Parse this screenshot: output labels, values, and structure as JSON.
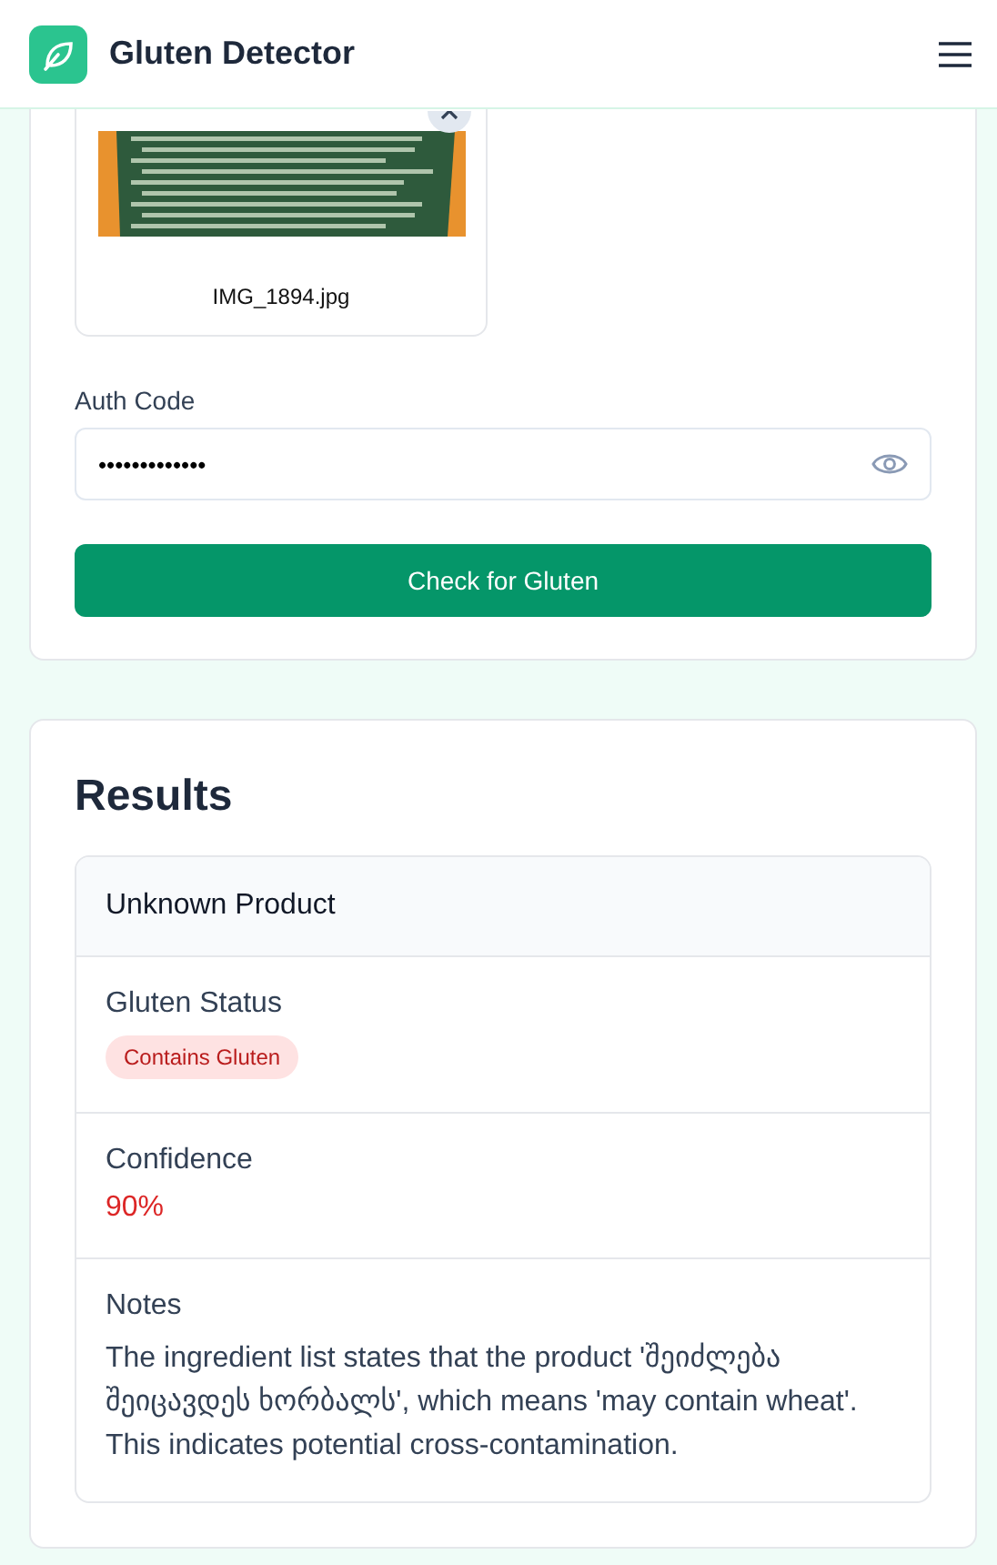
{
  "header": {
    "title": "Gluten Detector"
  },
  "upload": {
    "file_name": "IMG_1894.jpg"
  },
  "auth": {
    "label": "Auth Code",
    "value": "•••••••••••••"
  },
  "check_button": "Check for Gluten",
  "results": {
    "title": "Results",
    "product": "Unknown Product",
    "status": {
      "label": "Gluten Status",
      "badge": "Contains Gluten",
      "kind": "contains"
    },
    "confidence": {
      "label": "Confidence",
      "value": "90%"
    },
    "notes": {
      "label": "Notes",
      "text": "The ingredient list states that the product 'შეიძლება შეიცავდეს ხორბალს', which means 'may contain wheat'. This indicates potential cross-contamination."
    }
  }
}
